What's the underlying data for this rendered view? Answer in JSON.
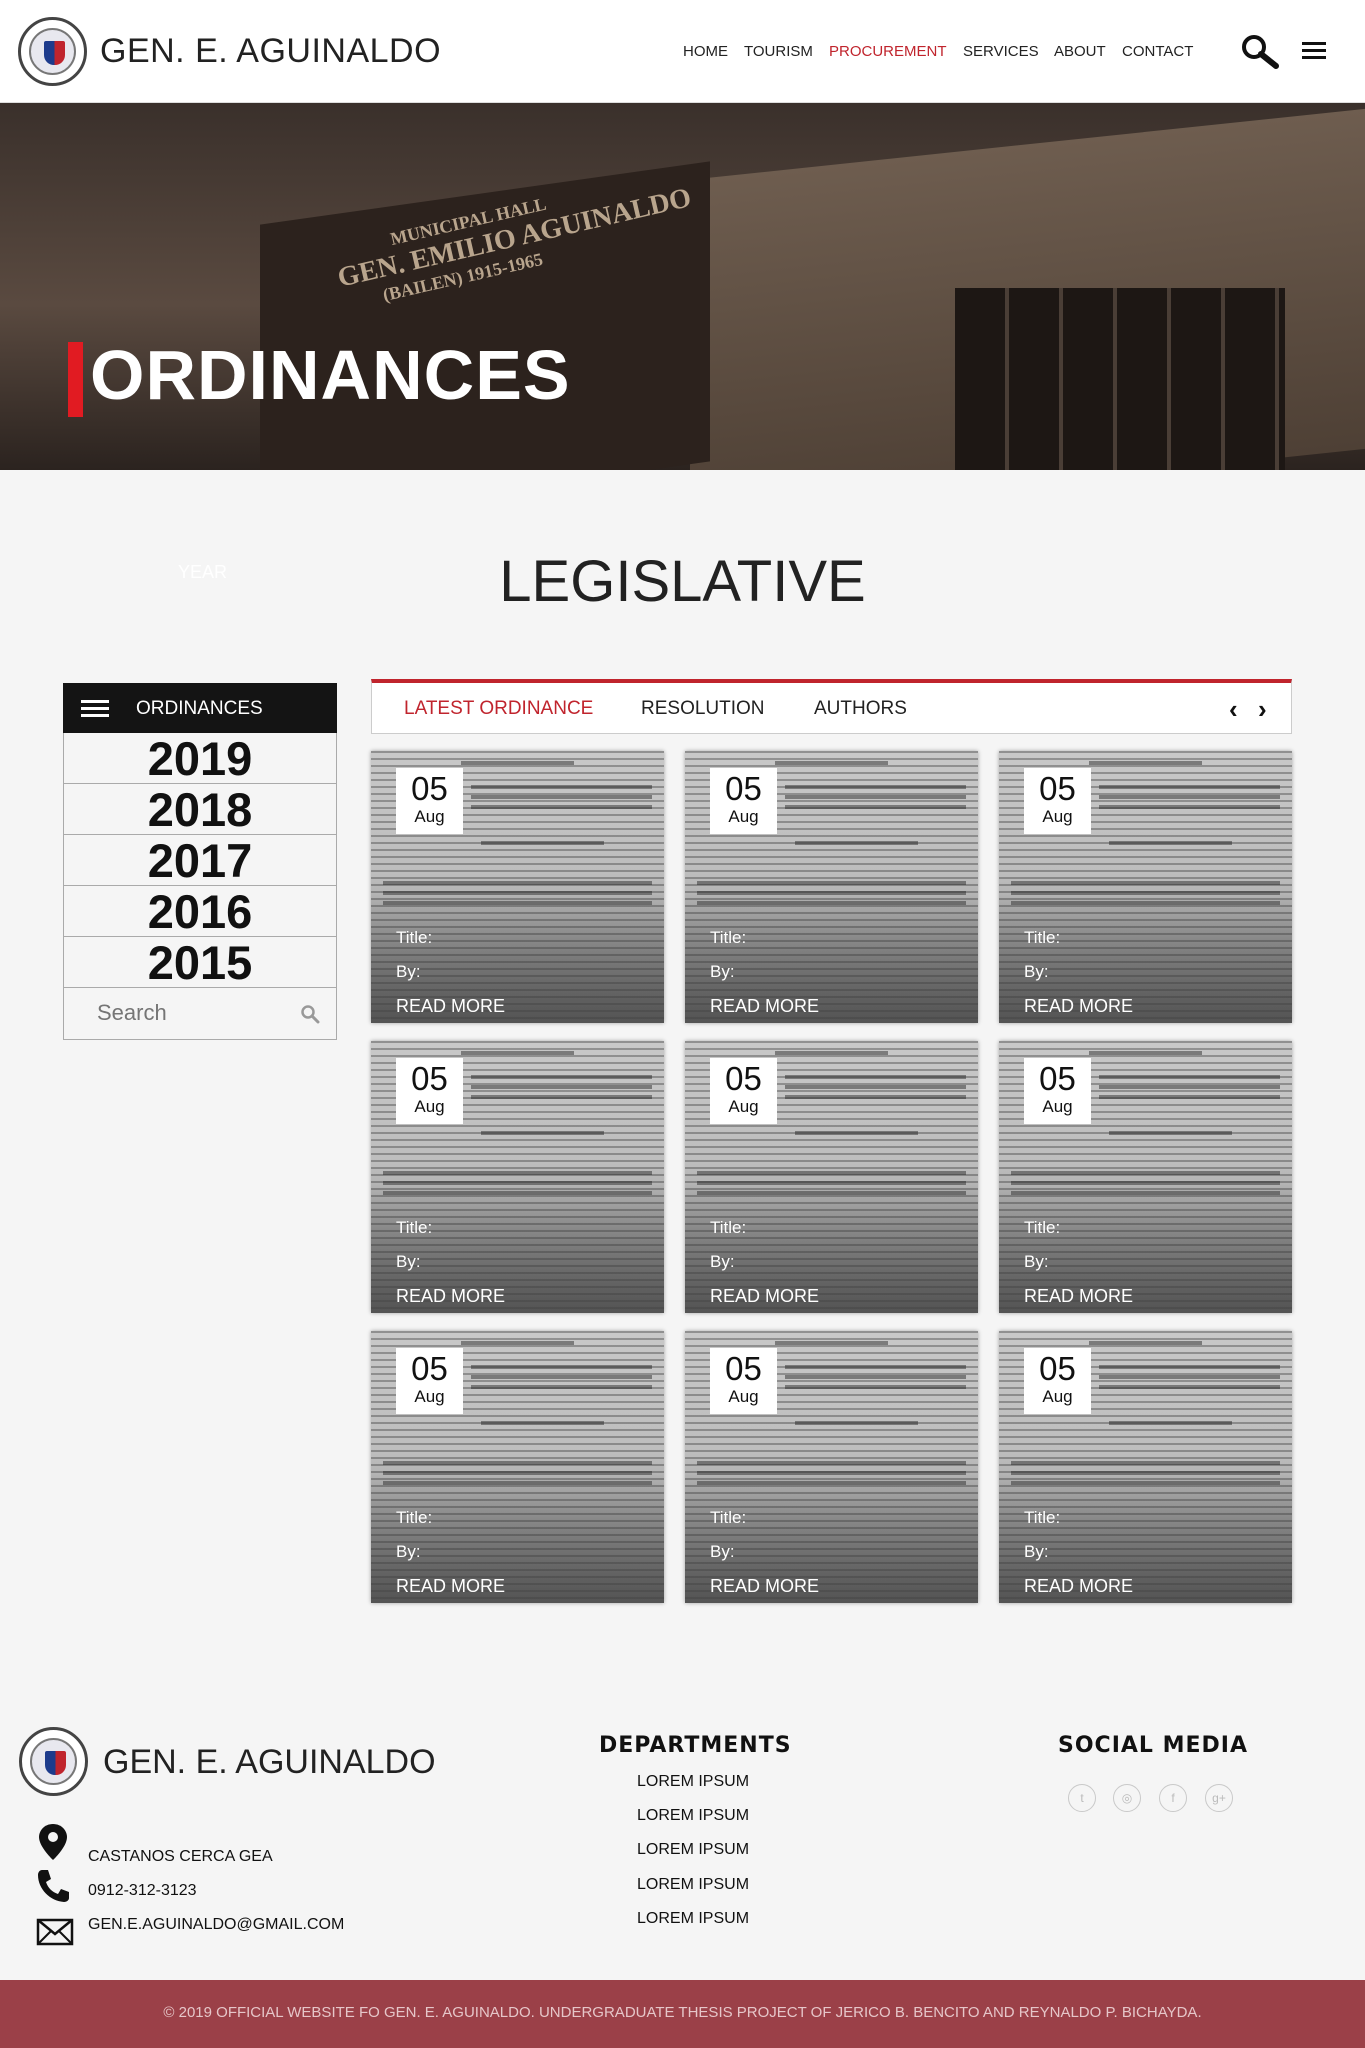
{
  "header": {
    "site_title": "GEN. E. AGUINALDO",
    "nav": [
      "HOME",
      "TOURISM",
      "PROCUREMENT",
      "SERVICES",
      "ABOUT",
      "CONTACT"
    ],
    "active_nav": "PROCUREMENT"
  },
  "hero": {
    "title": "ORDINANCES",
    "sign_line1": "MUNICIPAL HALL",
    "sign_line2": "GEN. EMILIO AGUINALDO",
    "sign_line3": "(BAILEN) 1915-1965"
  },
  "section": {
    "ghost_label": "YEAR",
    "title": "LEGISLATIVE"
  },
  "sidebar": {
    "heading": "ORDINANCES",
    "years": [
      "2019",
      "2018",
      "2017",
      "2016",
      "2015"
    ],
    "search_placeholder": "Search"
  },
  "tabs": {
    "items": [
      "LATEST ORDINANCE",
      "RESOLUTION",
      "AUTHORS"
    ],
    "active": "LATEST ORDINANCE",
    "prev": "‹",
    "next": "›"
  },
  "cards": [
    {
      "day": "05",
      "month": "Aug",
      "title_label": "Title:",
      "by_label": "By:",
      "read_more": "READ MORE"
    },
    {
      "day": "05",
      "month": "Aug",
      "title_label": "Title:",
      "by_label": "By:",
      "read_more": "READ MORE"
    },
    {
      "day": "05",
      "month": "Aug",
      "title_label": "Title:",
      "by_label": "By:",
      "read_more": "READ MORE"
    },
    {
      "day": "05",
      "month": "Aug",
      "title_label": "Title:",
      "by_label": "By:",
      "read_more": "READ MORE"
    },
    {
      "day": "05",
      "month": "Aug",
      "title_label": "Title:",
      "by_label": "By:",
      "read_more": "READ MORE"
    },
    {
      "day": "05",
      "month": "Aug",
      "title_label": "Title:",
      "by_label": "By:",
      "read_more": "READ MORE"
    },
    {
      "day": "05",
      "month": "Aug",
      "title_label": "Title:",
      "by_label": "By:",
      "read_more": "READ MORE"
    },
    {
      "day": "05",
      "month": "Aug",
      "title_label": "Title:",
      "by_label": "By:",
      "read_more": "READ MORE"
    },
    {
      "day": "05",
      "month": "Aug",
      "title_label": "Title:",
      "by_label": "By:",
      "read_more": "READ MORE"
    }
  ],
  "footer": {
    "site_title": "GEN. E. AGUINALDO",
    "address": "CASTANOS CERCA GEA",
    "phone": "0912-312-3123",
    "email": "GEN.E.AGUINALDO@GMAIL.COM",
    "departments_heading": "DEPARTMENTS",
    "departments": [
      "LOREM IPSUM",
      "LOREM IPSUM",
      "LOREM IPSUM",
      "LOREM IPSUM",
      "LOREM IPSUM"
    ],
    "social_heading": "SOCIAL MEDIA",
    "social_icons": [
      "twitter-icon",
      "instagram-icon",
      "facebook-icon",
      "google-plus-icon"
    ],
    "copyright": "© 2019 OFFICIAL WEBSITE FO GEN. E. AGUINALDO. UNDERGRADUATE THESIS PROJECT OF JERICO B. BENCITO AND REYNALDO P. BICHAYDA."
  },
  "colors": {
    "accent": "#c0242d",
    "hero_bar": "#e11b22",
    "footer_bar": "#9b4048",
    "sidebar_head": "#141414"
  }
}
